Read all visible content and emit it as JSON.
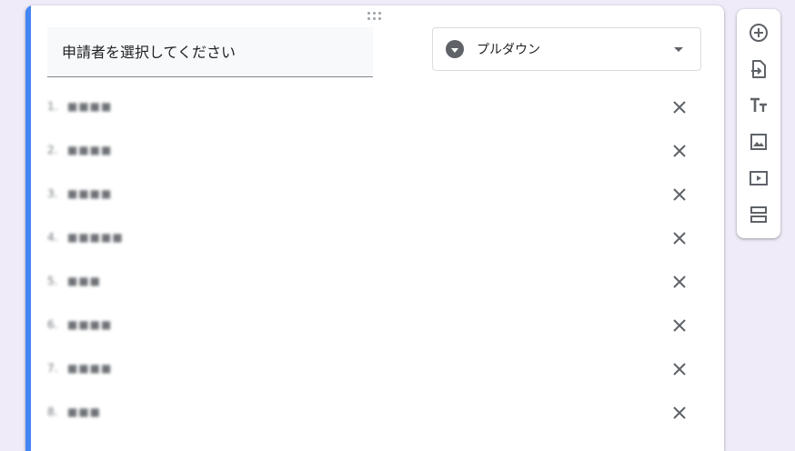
{
  "question": {
    "title": "申請者を選択してください",
    "type_label": "プルダウン"
  },
  "options": [
    {
      "num": "1.",
      "text": "■■■■"
    },
    {
      "num": "2.",
      "text": "■■■■"
    },
    {
      "num": "3.",
      "text": "■■■■"
    },
    {
      "num": "4.",
      "text": "■■■■■"
    },
    {
      "num": "5.",
      "text": "■■■"
    },
    {
      "num": "6.",
      "text": "■■■■"
    },
    {
      "num": "7.",
      "text": "■■■■"
    },
    {
      "num": "8.",
      "text": "■■■"
    }
  ],
  "sidebar_tools": [
    {
      "icon": "add-circle-icon"
    },
    {
      "icon": "import-questions-icon"
    },
    {
      "icon": "title-text-icon"
    },
    {
      "icon": "image-icon"
    },
    {
      "icon": "video-icon"
    },
    {
      "icon": "section-icon"
    }
  ],
  "colors": {
    "background": "#f0ebf8",
    "accent": "#4285f4",
    "icon": "#5f6368"
  }
}
